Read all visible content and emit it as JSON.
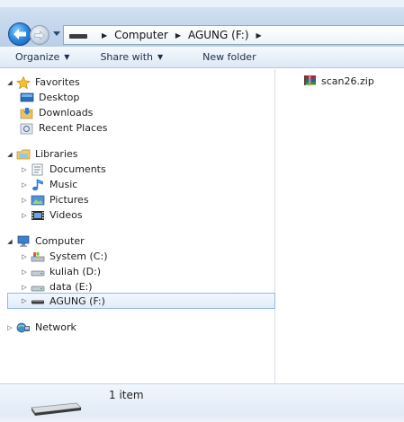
{
  "address": {
    "breadcrumbs": [
      "Computer",
      "AGUNG (F:)"
    ]
  },
  "toolbar": {
    "organize_label": "Organize",
    "share_label": "Share with",
    "new_folder_label": "New folder"
  },
  "nav": {
    "favorites": {
      "label": "Favorites",
      "items": [
        "Desktop",
        "Downloads",
        "Recent Places"
      ]
    },
    "libraries": {
      "label": "Libraries",
      "items": [
        "Documents",
        "Music",
        "Pictures",
        "Videos"
      ]
    },
    "computer": {
      "label": "Computer",
      "items": [
        "System (C:)",
        "kuliah (D:)",
        "data (E:)",
        "AGUNG (F:)"
      ],
      "selected": "AGUNG (F:)"
    },
    "network": {
      "label": "Network"
    }
  },
  "files": [
    {
      "name": "scan26.zip",
      "icon": "winrar-archive-icon"
    }
  ],
  "details": {
    "count_text": "1 item"
  },
  "colors": {
    "accent": "#2f8be0",
    "selection_border": "#93b9e5",
    "toolbar_text": "#1b2f4b"
  }
}
